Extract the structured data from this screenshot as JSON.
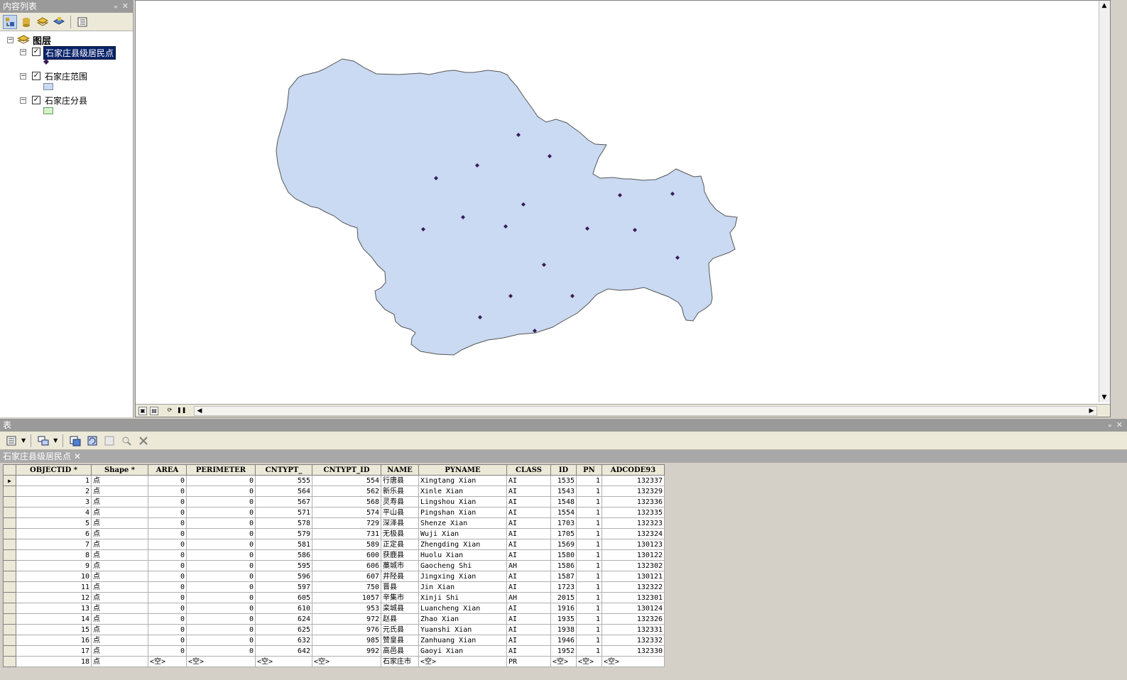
{
  "toc": {
    "title": "内容列表",
    "root_label": "图层",
    "layers": [
      {
        "label": "石家庄县级居民点",
        "checked": true,
        "selected": true,
        "symbol": "point"
      },
      {
        "label": "石家庄范围",
        "checked": true,
        "selected": false,
        "symbol": "fill-blue"
      },
      {
        "label": "石家庄分县",
        "checked": true,
        "selected": false,
        "symbol": "fill-green"
      }
    ],
    "colors": {
      "range_fill": "#c9daf2",
      "county_fill": "#d5f2c9",
      "point": "#3a1a5a"
    }
  },
  "table": {
    "title": "表",
    "layer_name": "石家庄县级居民点",
    "columns": [
      "OBJECTID *",
      "Shape *",
      "AREA",
      "PERIMETER",
      "CNTYPT_",
      "CNTYPT_ID",
      "NAME",
      "PYNAME",
      "CLASS",
      "ID",
      "PN",
      "ADCODE93"
    ],
    "rows": [
      [
        "1",
        "点",
        "0",
        "0",
        "555",
        "554",
        "行唐县",
        "Xingtang Xian",
        "AI",
        "1535",
        "1",
        "132337"
      ],
      [
        "2",
        "点",
        "0",
        "0",
        "564",
        "562",
        "新乐县",
        "Xinle Xian",
        "AI",
        "1543",
        "1",
        "132329"
      ],
      [
        "3",
        "点",
        "0",
        "0",
        "567",
        "568",
        "灵寿县",
        "Lingshou Xian",
        "AI",
        "1548",
        "1",
        "132336"
      ],
      [
        "4",
        "点",
        "0",
        "0",
        "571",
        "574",
        "平山县",
        "Pingshan Xian",
        "AI",
        "1554",
        "1",
        "132335"
      ],
      [
        "5",
        "点",
        "0",
        "0",
        "578",
        "729",
        "深泽县",
        "Shenze Xian",
        "AI",
        "1703",
        "1",
        "132323"
      ],
      [
        "6",
        "点",
        "0",
        "0",
        "579",
        "731",
        "无极县",
        "Wuji Xian",
        "AI",
        "1705",
        "1",
        "132324"
      ],
      [
        "7",
        "点",
        "0",
        "0",
        "581",
        "589",
        "正定县",
        "Zhengding Xian",
        "AI",
        "1569",
        "1",
        "130123"
      ],
      [
        "8",
        "点",
        "0",
        "0",
        "586",
        "600",
        "获鹿县",
        "Huolu Xian",
        "AI",
        "1580",
        "1",
        "130122"
      ],
      [
        "9",
        "点",
        "0",
        "0",
        "595",
        "606",
        "藁城市",
        "Gaocheng Shi",
        "AH",
        "1586",
        "1",
        "132302"
      ],
      [
        "10",
        "点",
        "0",
        "0",
        "596",
        "607",
        "井陉县",
        "Jingxing Xian",
        "AI",
        "1587",
        "1",
        "130121"
      ],
      [
        "11",
        "点",
        "0",
        "0",
        "597",
        "750",
        "晋县",
        "Jin Xian",
        "AI",
        "1723",
        "1",
        "132322"
      ],
      [
        "12",
        "点",
        "0",
        "0",
        "605",
        "1057",
        "辛集市",
        "Xinji Shi",
        "AH",
        "2015",
        "1",
        "132301"
      ],
      [
        "13",
        "点",
        "0",
        "0",
        "610",
        "953",
        "栾城县",
        "Luancheng Xian",
        "AI",
        "1916",
        "1",
        "130124"
      ],
      [
        "14",
        "点",
        "0",
        "0",
        "624",
        "972",
        "赵县",
        "Zhao Xian",
        "AI",
        "1935",
        "1",
        "132326"
      ],
      [
        "15",
        "点",
        "0",
        "0",
        "625",
        "976",
        "元氏县",
        "Yuanshi Xian",
        "AI",
        "1938",
        "1",
        "132331"
      ],
      [
        "16",
        "点",
        "0",
        "0",
        "632",
        "985",
        "赞皇县",
        "Zanhuang Xian",
        "AI",
        "1946",
        "1",
        "132332"
      ],
      [
        "17",
        "点",
        "0",
        "0",
        "642",
        "992",
        "高邑县",
        "Gaoyi Xian",
        "AI",
        "1952",
        "1",
        "132330"
      ],
      [
        "18",
        "点",
        "<空>",
        "<空>",
        "<空>",
        "<空>",
        "石家庄市",
        "<空>",
        "PR",
        "<空>",
        "<空>",
        "<空>"
      ]
    ]
  }
}
